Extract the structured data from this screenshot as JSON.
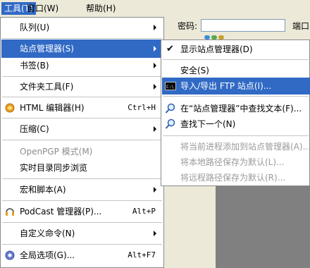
{
  "menubar": {
    "items": [
      {
        "label": "工具(T)",
        "open": true
      },
      {
        "label": "窗口(W)",
        "open": false
      },
      {
        "label": "帮助(H)",
        "open": false
      }
    ]
  },
  "toolbar": {
    "password_label": "密码:",
    "port_label": "端口"
  },
  "main_menu": {
    "items": [
      {
        "label": "队列(U)",
        "submenu": true
      },
      {
        "label": "站点管理器(S)",
        "submenu": true,
        "highlighted": true
      },
      {
        "label": "书签(B)",
        "submenu": true
      },
      {
        "label": "文件夹工具(F)",
        "submenu": true
      },
      {
        "label": "HTML 编辑器(H)",
        "shortcut": "Ctrl+H",
        "icon": "html-editor-icon"
      },
      {
        "label": "压缩(C)",
        "submenu": true
      },
      {
        "label": "OpenPGP 模式(M)",
        "disabled": true
      },
      {
        "label": "实时目录同步浏览"
      },
      {
        "label": "宏和脚本(A)",
        "submenu": true
      },
      {
        "label": "PodCast 管理器(P)...",
        "shortcut": "Alt+P",
        "icon": "podcast-headphones-icon"
      },
      {
        "label": "自定义命令(N)",
        "submenu": true
      },
      {
        "label": "全局选项(G)...",
        "shortcut": "Alt+F7",
        "icon": "global-options-icon"
      }
    ]
  },
  "sub_menu": {
    "items": [
      {
        "label": "显示站点管理器(D)",
        "checked": true
      },
      {
        "label": "安全(S)"
      },
      {
        "label": "导入/导出 FTP 站点(I)...",
        "highlighted": true,
        "icon": "command-prompt-icon"
      },
      {
        "label": "在“站点管理器”中查找文本(F)...",
        "icon": "find-icon"
      },
      {
        "label": "查找下一个(N)",
        "icon": "find-next-icon"
      },
      {
        "label": "将当前进程添加到站点管理器(A)...",
        "disabled": true
      },
      {
        "label": "将本地路径保存为默认(L)...",
        "disabled": true
      },
      {
        "label": "将远程路径保存为默认(R)...",
        "disabled": true
      }
    ]
  }
}
